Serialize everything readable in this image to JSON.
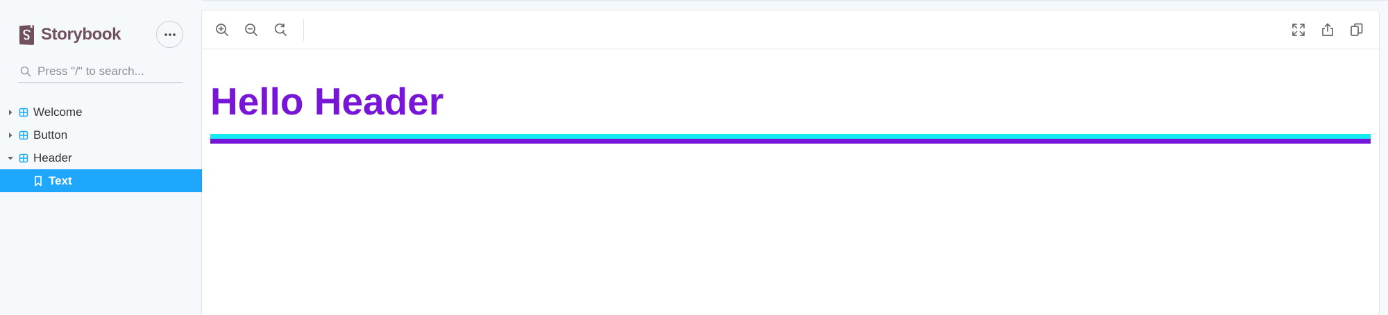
{
  "brand": {
    "name": "Storybook"
  },
  "search": {
    "placeholder": "Press \"/\" to search..."
  },
  "sidebar": {
    "items": [
      {
        "label": "Welcome",
        "expanded": false
      },
      {
        "label": "Button",
        "expanded": false
      },
      {
        "label": "Header",
        "expanded": true
      },
      {
        "label": "Text",
        "selected": true
      }
    ]
  },
  "toolbar": {
    "left_icons": [
      "zoom-in-icon",
      "zoom-out-icon",
      "zoom-reset-icon"
    ],
    "right_icons": [
      "fullscreen-icon",
      "share-icon",
      "copy-icon"
    ]
  },
  "preview": {
    "heading": "Hello Header",
    "colors": {
      "heading": "#7716d6",
      "accent_cyan": "#14ebf0",
      "accent_purple": "#7716d6"
    }
  },
  "theme": {
    "selected": "#1ea7fd",
    "brand_color": "#71505e"
  }
}
